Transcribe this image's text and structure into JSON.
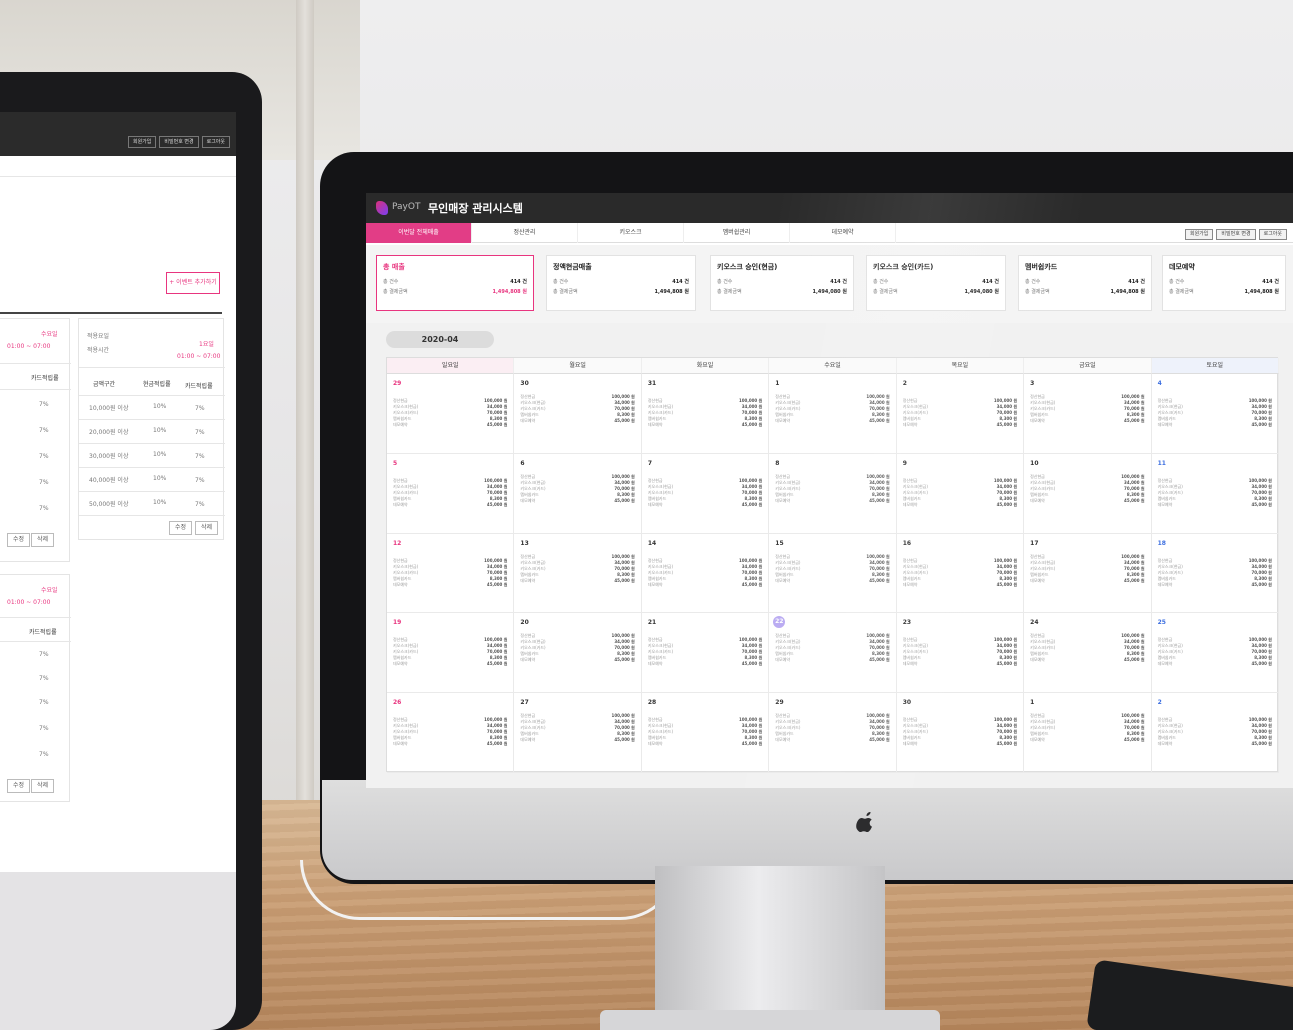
{
  "app": {
    "brand": "PayOT",
    "title": "무인매장 관리시스템"
  },
  "colors": {
    "accent": "#e23d86",
    "dark": "#2a2a2a",
    "today": "#b8a9f2"
  },
  "nav": {
    "tabs": [
      {
        "label": "이번달 전체매출",
        "active": true
      },
      {
        "label": "정산관리"
      },
      {
        "label": "키오스크"
      },
      {
        "label": "멤버쉽관리"
      },
      {
        "label": "데모예약"
      }
    ],
    "header_buttons": [
      "회원가입",
      "비밀번호 변경",
      "로그아웃"
    ]
  },
  "stats": [
    {
      "title": "총 매출",
      "count_label": "총 건수",
      "count": "414 건",
      "amount_label": "총 결제금액",
      "amount": "1,494,808 원"
    },
    {
      "title": "정액현금매출",
      "count_label": "총 건수",
      "count": "414 건",
      "amount_label": "총 결제금액",
      "amount": "1,494,808 원"
    },
    {
      "title": "키오스크 승인(현금)",
      "count_label": "총 건수",
      "count": "414 건",
      "amount_label": "총 결제금액",
      "amount": "1,494,080 원"
    },
    {
      "title": "키오스크 승인(카드)",
      "count_label": "총 건수",
      "count": "414 건",
      "amount_label": "총 결제금액",
      "amount": "1,494,080 원"
    },
    {
      "title": "멤버쉽카드",
      "count_label": "총 건수",
      "count": "414 건",
      "amount_label": "총 결제금액",
      "amount": "1,494,808 원"
    },
    {
      "title": "데모예약",
      "count_label": "총 건수",
      "count": "414 건",
      "amount_label": "총 결제금액",
      "amount": "1,494,808 원"
    }
  ],
  "calendar": {
    "month": "2020-04",
    "weekdays": [
      "일요일",
      "월요일",
      "화요일",
      "수요일",
      "목요일",
      "금요일",
      "토요일"
    ],
    "weeks": [
      [
        "29",
        "30",
        "31",
        "1",
        "2",
        "3",
        "4"
      ],
      [
        "5",
        "6",
        "7",
        "8",
        "9",
        "10",
        "11"
      ],
      [
        "12",
        "13",
        "14",
        "15",
        "16",
        "17",
        "18"
      ],
      [
        "19",
        "20",
        "21",
        "22",
        "23",
        "24",
        "25"
      ],
      [
        "26",
        "27",
        "28",
        "29",
        "30",
        "1",
        "2"
      ]
    ],
    "today": "22",
    "entries": [
      {
        "label": "정산현금",
        "value": "100,000 원"
      },
      {
        "label": "키오스크(현금)",
        "value": "34,000 원"
      },
      {
        "label": "키오스크(카드)",
        "value": "70,000 원"
      },
      {
        "label": "멤버쉽카드",
        "value": "8,300 원"
      },
      {
        "label": "데모예약",
        "value": "45,000 원"
      }
    ]
  },
  "left_screen": {
    "top_buttons": [
      "회원가입",
      "비밀번호 변경",
      "로그아웃"
    ],
    "add_button": "+ 이벤트 추가하기",
    "panel1": {
      "label_pink": "수요일",
      "time": "01:00 ~ 07:00",
      "col_header": "카드적립률",
      "rates": [
        "7%",
        "7%",
        "7%",
        "7%",
        "7%"
      ],
      "edit": "수정",
      "delete": "삭제"
    },
    "panel2": {
      "apply_label": "적용요일",
      "time_label": "적용시간",
      "day_value": "1요일",
      "time_value": "01:00 ~ 07:00",
      "headers": [
        "금액구간",
        "현금적립률",
        "카드적립률"
      ],
      "rows": [
        [
          "10,000원 이상",
          "10%",
          "7%"
        ],
        [
          "20,000원 이상",
          "10%",
          "7%"
        ],
        [
          "30,000원 이상",
          "10%",
          "7%"
        ],
        [
          "40,000원 이상",
          "10%",
          "7%"
        ],
        [
          "50,000원 이상",
          "10%",
          "7%"
        ]
      ],
      "edit": "수정",
      "delete": "삭제"
    },
    "panel3": {
      "label_pink": "수요일",
      "time": "01:00 ~ 07:00",
      "col_header": "카드적립률",
      "rates": [
        "7%",
        "7%",
        "7%",
        "7%",
        "7%"
      ],
      "edit": "수정",
      "delete": "삭제"
    }
  }
}
